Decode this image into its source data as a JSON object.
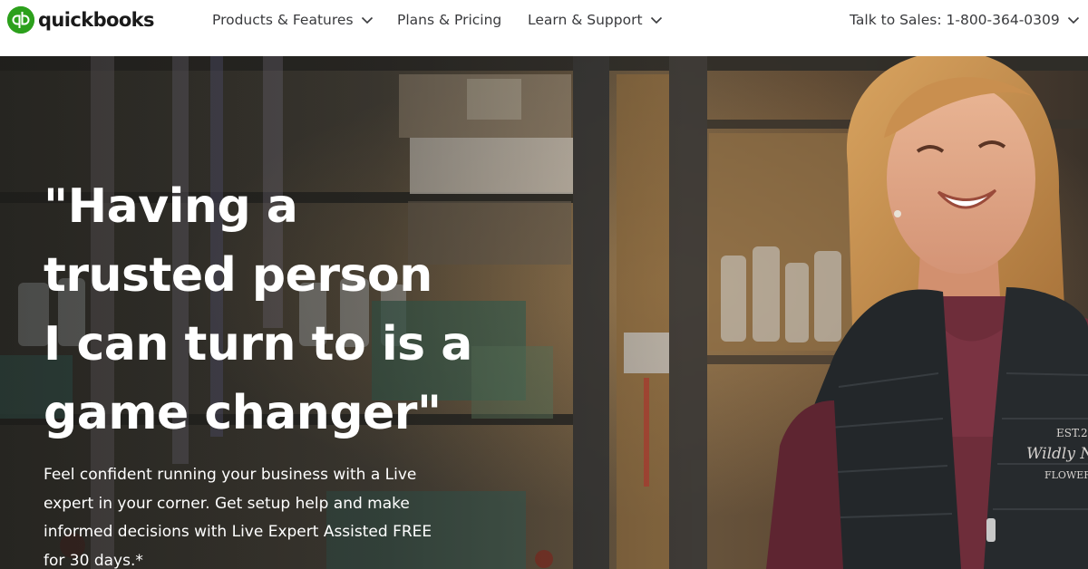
{
  "brand": {
    "name": "quickbooks",
    "mark_text": "qb",
    "accent_color": "#2ca01c"
  },
  "nav": {
    "items": [
      {
        "label": "Products & Features",
        "icon": "chevron-down-icon"
      },
      {
        "label": "Plans & Pricing"
      },
      {
        "label": "Learn & Support",
        "icon": "chevron-down-icon"
      }
    ],
    "sales": {
      "label": "Talk to Sales: 1-800-364-0309",
      "icon": "chevron-down-icon"
    }
  },
  "hero": {
    "headline_lines": [
      "\"Having a",
      "trusted person",
      "I can turn to is a",
      "game changer\""
    ],
    "subtext": "Feel confident running your business with a Live expert in your corner. Get setup help and make informed decisions with Live Expert Assisted FREE for 30 days.*",
    "vest_text": [
      "EST.2",
      "Wildly N",
      "FLOWER"
    ]
  }
}
